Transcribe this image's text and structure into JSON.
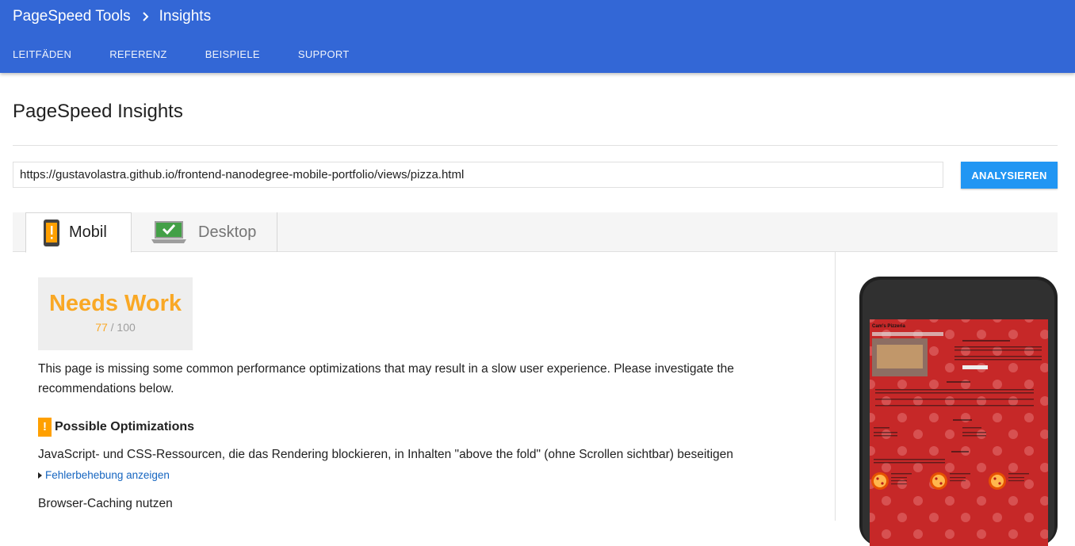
{
  "header": {
    "product": "PageSpeed Tools",
    "current": "Insights",
    "nav": [
      "LEITFÄDEN",
      "REFERENZ",
      "BEISPIELE",
      "SUPPORT"
    ]
  },
  "page": {
    "title": "PageSpeed Insights",
    "url_value": "https://gustavolastra.github.io/frontend-nanodegree-mobile-portfolio/views/pizza.html",
    "analyze_label": "ANALYSIEREN"
  },
  "tabs": {
    "mobile": "Mobil",
    "desktop": "Desktop"
  },
  "result": {
    "verdict": "Needs Work",
    "score": "77",
    "max": "/ 100",
    "summary": "This page is missing some common performance optimizations that may result in a slow user experience. Please investigate the recommendations below.",
    "section_title": "Possible Optimizations",
    "section_icon": "!",
    "rule1": "JavaScript- und CSS-Ressourcen, die das Rendering blockieren, in Inhalten \"above the fold\" (ohne Scrollen sichtbar) beseitigen",
    "fix_link": "Fehlerbehebung anzeigen",
    "rule2": "Browser-Caching nutzen"
  },
  "preview": {
    "site_title": "Cam's Pizzeria"
  },
  "colors": {
    "header_bg": "#3367d6",
    "button_bg": "#2196f3",
    "warning": "#f9a825",
    "link": "#1565c0",
    "preview_bg": "#c62828"
  }
}
